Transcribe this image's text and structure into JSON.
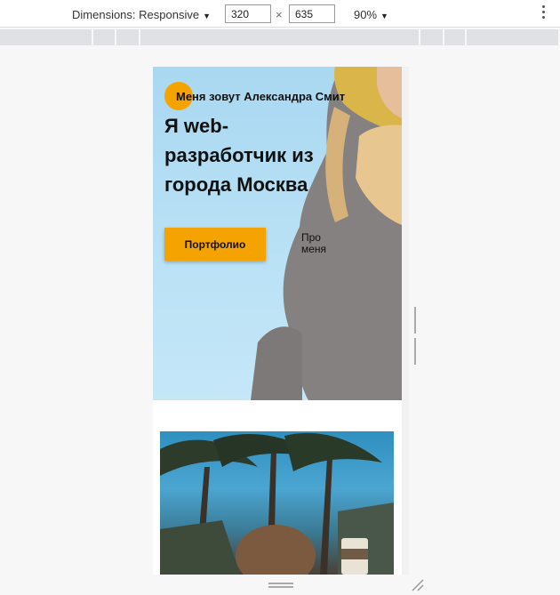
{
  "devtools": {
    "dimensions_label": "Dimensions: Responsive",
    "width_value": "320",
    "height_value": "635",
    "zoom_label": "90%",
    "times_sign": "×"
  },
  "hero": {
    "name": "Меня зовут Александра Смит",
    "title": "Я web-разработчик из города Москва",
    "portfolio_button": "Портфолио",
    "about_button": "Про меня",
    "accent_color": "#f5a300"
  }
}
